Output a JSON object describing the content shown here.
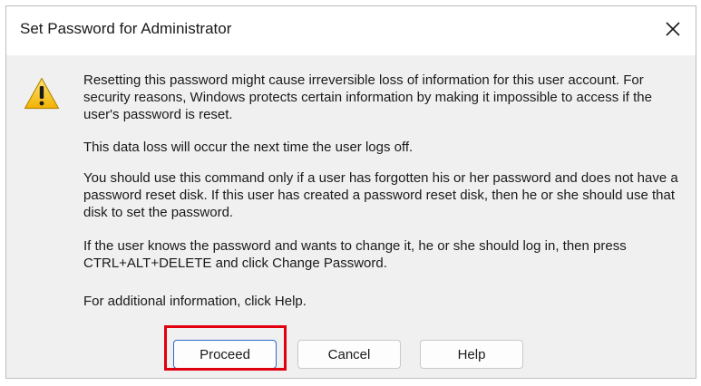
{
  "window": {
    "title": "Set Password for Administrator",
    "close_icon": "close-icon"
  },
  "content": {
    "icon": "warning-icon",
    "paragraph_1": "Resetting this password might cause irreversible loss of information for this user account. For security reasons, Windows protects certain information by making it impossible to access if the user's password is reset.",
    "paragraph_2": "This data loss will occur the next time the user logs off.",
    "paragraph_3": "You should use this command only if a user has forgotten his or her password and does not have a password reset disk. If this user has created a password reset disk, then he or she should use that disk to set the password.",
    "paragraph_4": "If the user knows the password and wants to change it, he or she should log in, then press CTRL+ALT+DELETE and click Change Password.",
    "paragraph_5": "For additional information, click Help."
  },
  "buttons": {
    "proceed_label": "Proceed",
    "cancel_label": "Cancel",
    "help_label": "Help"
  },
  "colors": {
    "highlight": "#e0000f",
    "focus_border": "#2a68c8",
    "dialog_background": "#f0f0f0"
  }
}
